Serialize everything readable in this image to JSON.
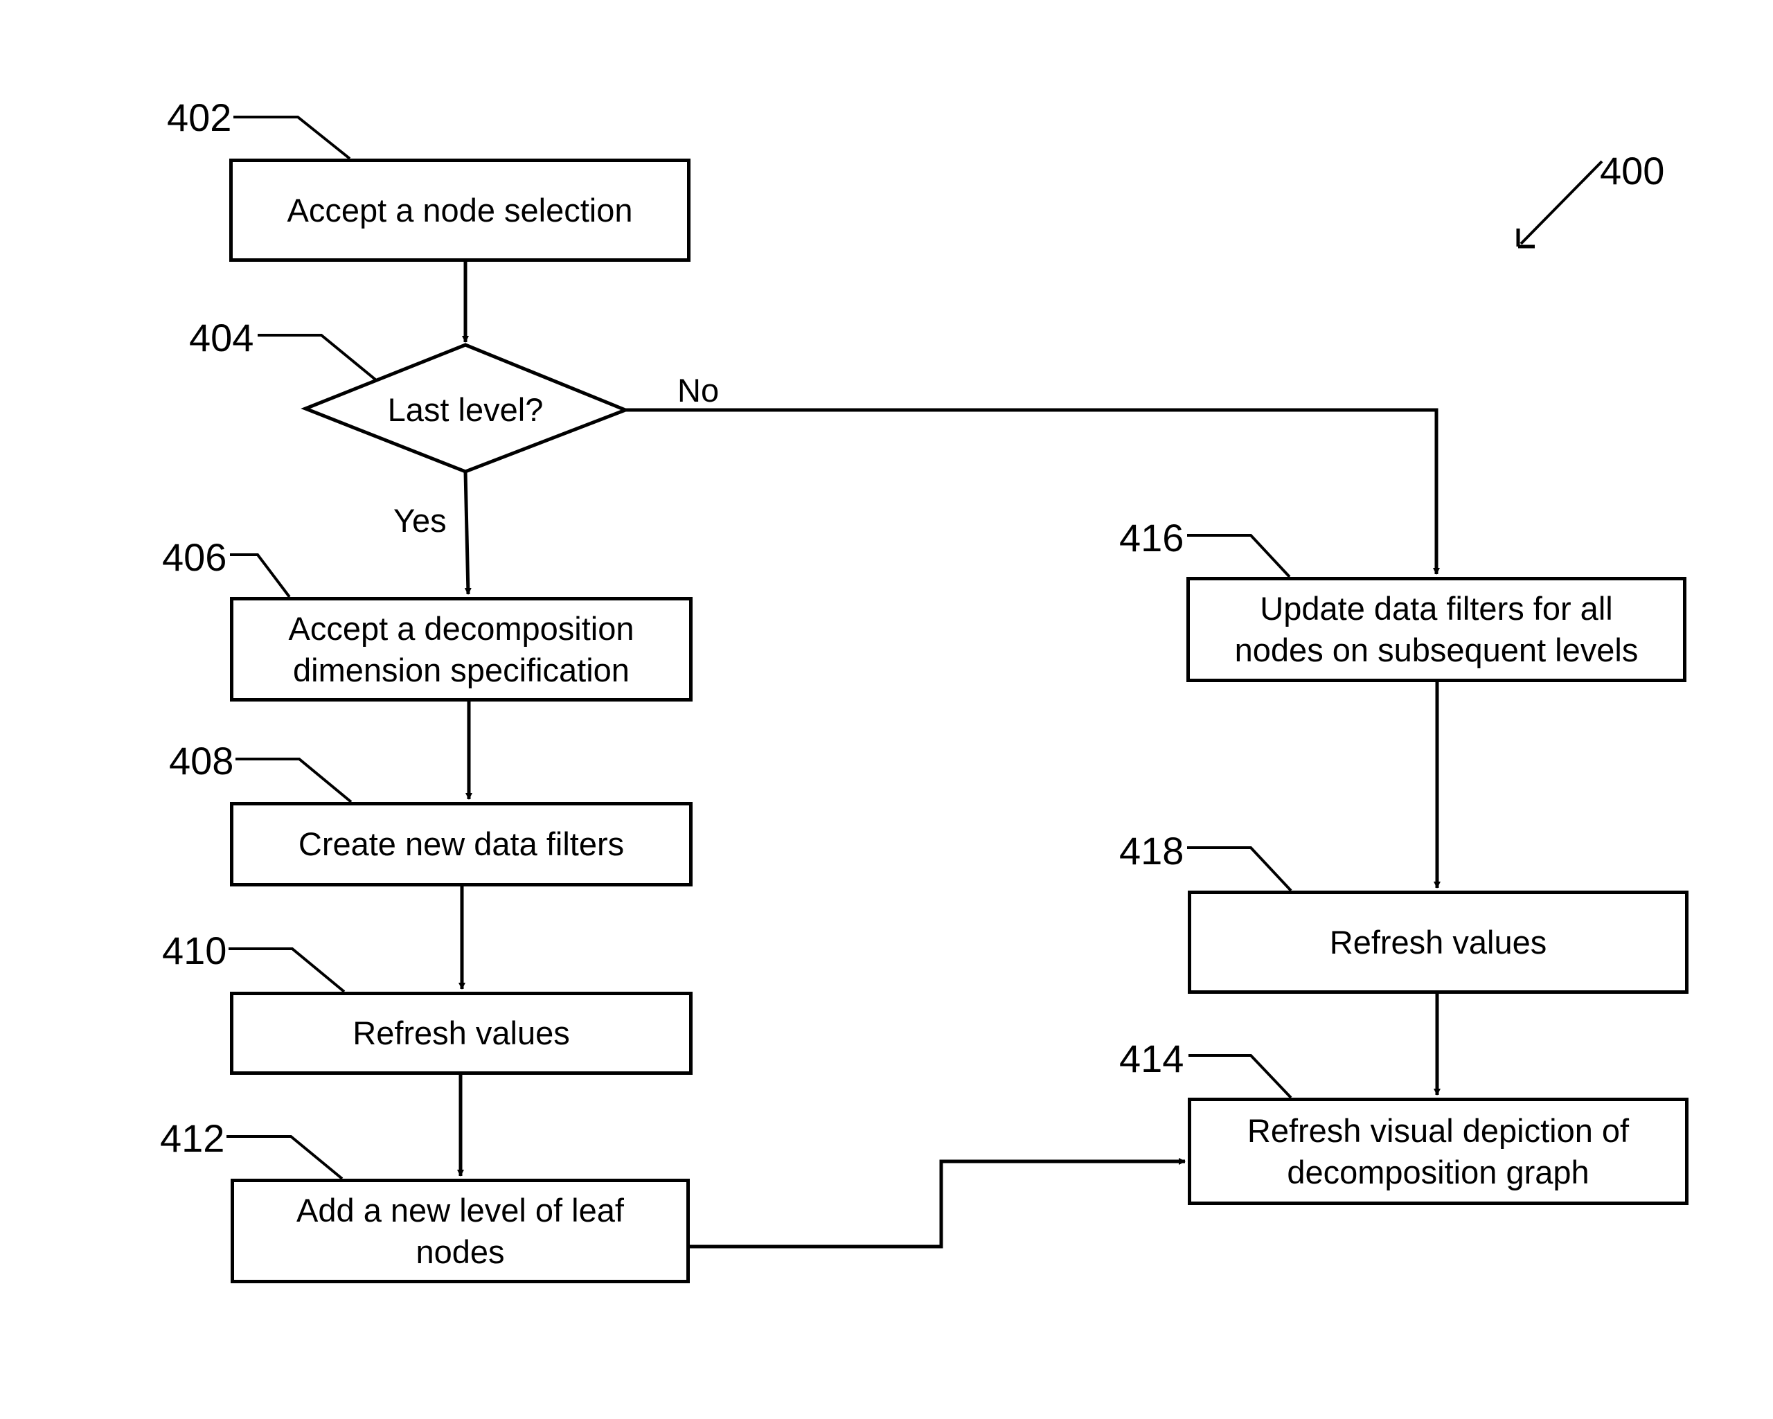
{
  "figure": {
    "reference": "400",
    "nodes": [
      {
        "id": "402",
        "type": "process",
        "lines": [
          "Accept a node selection"
        ]
      },
      {
        "id": "404",
        "type": "decision",
        "lines": [
          "Last level?"
        ]
      },
      {
        "id": "406",
        "type": "process",
        "lines": [
          "Accept a decomposition",
          "dimension specification"
        ]
      },
      {
        "id": "408",
        "type": "process",
        "lines": [
          "Create new data filters"
        ]
      },
      {
        "id": "410",
        "type": "process",
        "lines": [
          "Refresh values"
        ]
      },
      {
        "id": "412",
        "type": "process",
        "lines": [
          "Add a new level of leaf",
          "nodes"
        ]
      },
      {
        "id": "416",
        "type": "process",
        "lines": [
          "Update data filters for all",
          "nodes on subsequent levels"
        ]
      },
      {
        "id": "418",
        "type": "process",
        "lines": [
          "Refresh values"
        ]
      },
      {
        "id": "414",
        "type": "process",
        "lines": [
          "Refresh visual depiction of",
          "decomposition graph"
        ]
      }
    ],
    "edges": [
      {
        "from": "402",
        "to": "404",
        "label": ""
      },
      {
        "from": "404",
        "to": "406",
        "label": "Yes"
      },
      {
        "from": "404",
        "to": "416",
        "label": "No"
      },
      {
        "from": "406",
        "to": "408",
        "label": ""
      },
      {
        "from": "408",
        "to": "410",
        "label": ""
      },
      {
        "from": "410",
        "to": "412",
        "label": ""
      },
      {
        "from": "412",
        "to": "414",
        "label": ""
      },
      {
        "from": "416",
        "to": "418",
        "label": ""
      },
      {
        "from": "418",
        "to": "414",
        "label": ""
      }
    ],
    "colors": {
      "stroke": "#000000",
      "background": "#ffffff"
    }
  }
}
